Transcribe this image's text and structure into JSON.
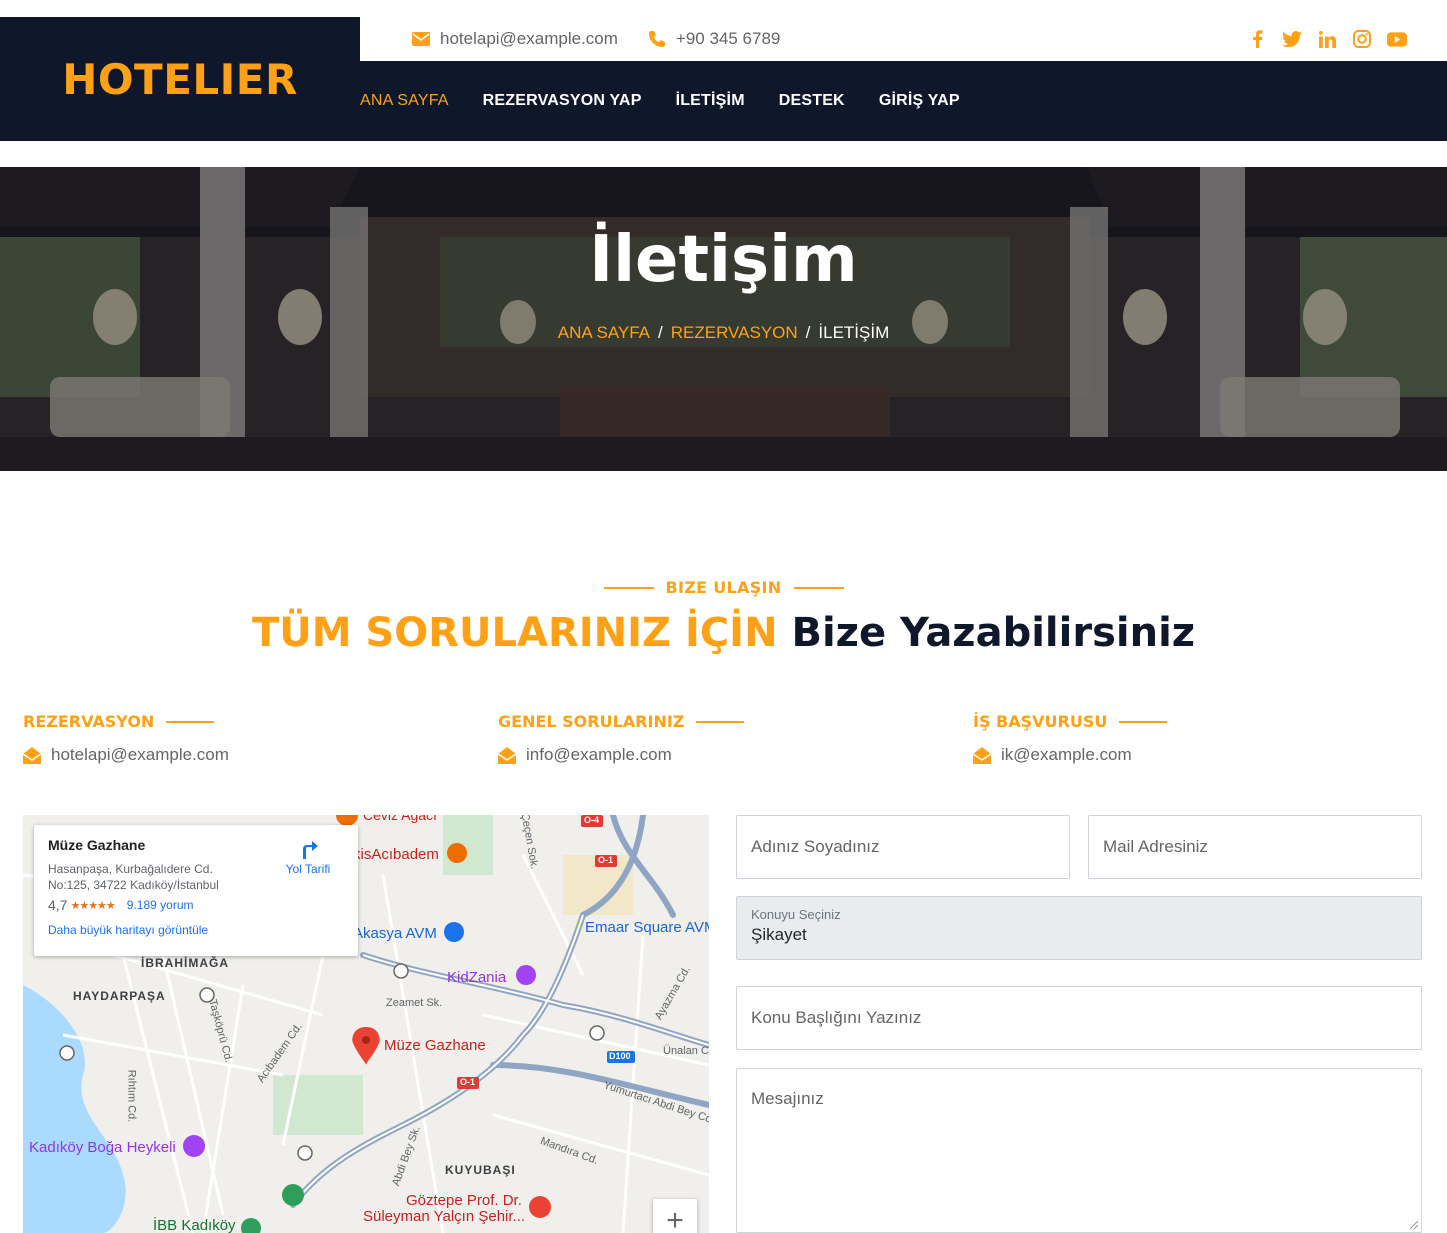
{
  "brand": {
    "logo": "HOTELIER"
  },
  "topbar": {
    "email": "hotelapi@example.com",
    "phone": "+90 345 6789",
    "socials": [
      "facebook-icon",
      "twitter-icon",
      "linkedin-icon",
      "instagram-icon",
      "youtube-icon"
    ]
  },
  "nav": {
    "items": [
      {
        "label": "ANA SAYFA",
        "active": true
      },
      {
        "label": "REZERVASYON YAP"
      },
      {
        "label": "İLETİŞİM"
      },
      {
        "label": "DESTEK"
      },
      {
        "label": "GİRİŞ YAP"
      }
    ]
  },
  "hero": {
    "title": "İletişim",
    "breadcrumb": [
      "ANA SAYFA",
      "REZERVASYON",
      "İLETİŞİM"
    ],
    "separator": "/"
  },
  "section": {
    "subtitle": "BIZE ULAŞIN",
    "title_accent": "TÜM SORULARINIZ İÇİN",
    "title_dark": "Bize Yazabilirsiniz"
  },
  "contacts": [
    {
      "heading": "REZERVASYON",
      "email": "hotelapi@example.com"
    },
    {
      "heading": "GENEL SORULARINIZ",
      "email": "info@example.com"
    },
    {
      "heading": "İŞ BAŞVURUSU",
      "email": "ik@example.com"
    }
  ],
  "map": {
    "place": "Müze Gazhane",
    "address": "Hasanpaşa, Kurbağalıdere Cd. No:125, 34722 Kadıköy/İstanbul",
    "rating": "4,7",
    "stars": "★★★★★",
    "reviews": "9.189 yorum",
    "bigger_map": "Daha büyük haritayı görüntüle",
    "directions": "Yol Tarifi",
    "labels": {
      "marker": "Müze Gazhane",
      "ceviz": "Ceviz Ağacı",
      "acibadem": "kisAcıbadem",
      "akasya": "Akasya AVM",
      "emaar": "Emaar Square AVM",
      "kidzania": "KidZania",
      "ibrahimaga": "İBRAHİMAĞA",
      "haydarpasa": "HAYDARPAŞA",
      "zeamet": "Zeamet Sk.",
      "taskopru": "Taşköprü Cd.",
      "acibadem_cd": "Acıbadem Cd.",
      "rihtim": "Rıhtım Cd.",
      "ayazma": "Ayazma Cd.",
      "unalan": "Ünalan Cd.",
      "yumurtaci": "Yumurtacı Abdi Bey Cd.",
      "mandira": "Mandıra Cd.",
      "kuyubasi": "KUYUBAŞI",
      "abdi": "Abdi Bey Sk.",
      "kadikoy": "Kadıköy Boğa Heykeli",
      "goztepe": "Göztepe Prof. Dr.",
      "suleyman": "Süleyman Yalçın Şehir...",
      "ibb": "İBB Kadıköy",
      "cecen": "Çeçen Sok.",
      "o4": "O-4",
      "o1a": "O-1",
      "o1b": "O-1",
      "d100": "D100"
    },
    "zoom": "+"
  },
  "form": {
    "name_placeholder": "Adınız Soyadınız",
    "email_placeholder": "Mail Adresiniz",
    "subject_label": "Konuyu Seçiniz",
    "subject_value": "Şikayet",
    "title_placeholder": "Konu Başlığını Yazınız",
    "message_placeholder": "Mesajınız"
  },
  "colors": {
    "accent": "#fea116",
    "dark": "#0f172b"
  }
}
